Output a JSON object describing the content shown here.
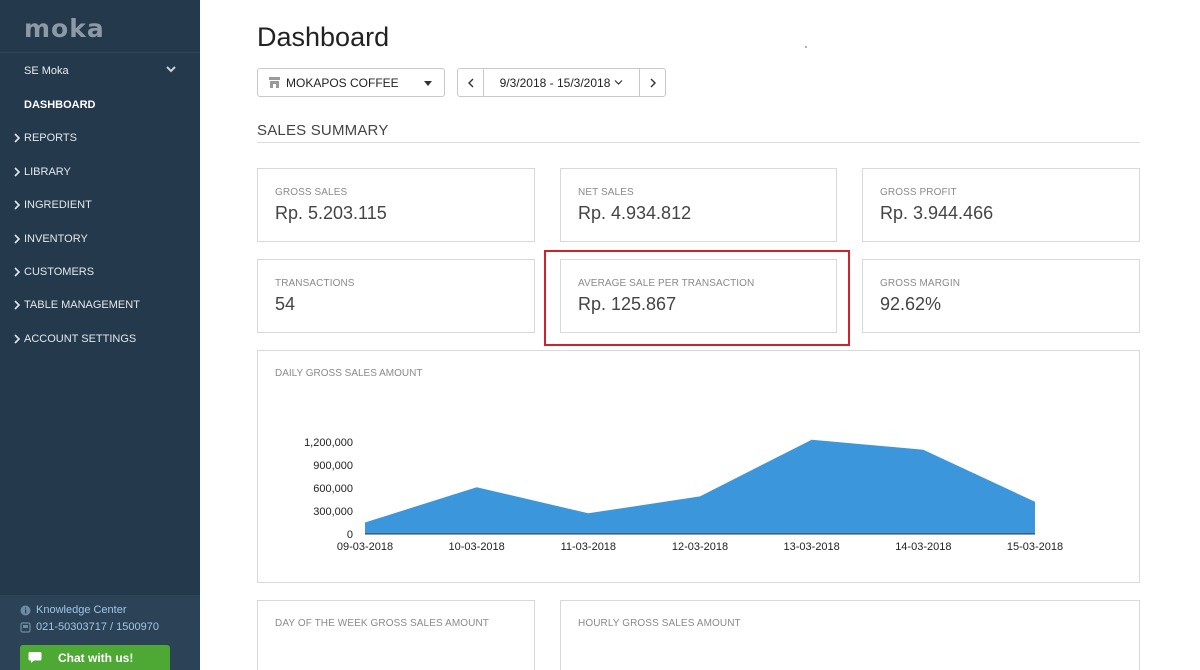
{
  "app": {
    "brand": "moka",
    "account_name": "SE Moka"
  },
  "sidebar": {
    "active_item": "DASHBOARD",
    "items": [
      {
        "label": "REPORTS"
      },
      {
        "label": "LIBRARY"
      },
      {
        "label": "INGREDIENT"
      },
      {
        "label": "INVENTORY"
      },
      {
        "label": "CUSTOMERS"
      },
      {
        "label": "TABLE MANAGEMENT"
      },
      {
        "label": "ACCOUNT SETTINGS"
      }
    ],
    "footer": {
      "knowledge_center": "Knowledge Center",
      "phone": "021-50303717 / 1500970",
      "chat_label": "Chat with us!"
    }
  },
  "page": {
    "title": "Dashboard"
  },
  "filters": {
    "store": "MOKAPOS COFFEE",
    "date_range": "9/3/2018 - 15/3/2018"
  },
  "summary": {
    "title": "SALES SUMMARY",
    "gross_sales": {
      "label": "GROSS SALES",
      "value": "Rp. 5.203.115"
    },
    "net_sales": {
      "label": "NET SALES",
      "value": "Rp. 4.934.812"
    },
    "gross_profit": {
      "label": "GROSS PROFIT",
      "value": "Rp. 3.944.466"
    },
    "transactions": {
      "label": "TRANSACTIONS",
      "value": "54"
    },
    "avg_sale": {
      "label": "AVERAGE SALE PER TRANSACTION",
      "value": "Rp. 125.867"
    },
    "gross_margin": {
      "label": "GROSS MARGIN",
      "value": "92.62%"
    }
  },
  "bottom_cards": {
    "day_of_week": "DAY OF THE WEEK GROSS SALES AMOUNT",
    "hourly": "HOURLY GROSS SALES AMOUNT"
  },
  "colors": {
    "sidebar_bg": "#24394b",
    "area_fill": "#3b96dc",
    "highlight": "#d0222c",
    "chat_green": "#4ea834"
  },
  "chart_data": {
    "type": "area",
    "title": "DAILY GROSS SALES AMOUNT",
    "categories": [
      "09-03-2018",
      "10-03-2018",
      "11-03-2018",
      "12-03-2018",
      "13-03-2018",
      "14-03-2018",
      "15-03-2018"
    ],
    "values": [
      150000,
      610000,
      270000,
      490000,
      1230000,
      1100000,
      420000
    ],
    "yticks": [
      0,
      300000,
      600000,
      900000,
      1200000
    ],
    "ytick_labels": [
      "0",
      "300,000",
      "600,000",
      "900,000",
      "1,200,000"
    ],
    "ylim": [
      0,
      1200000
    ],
    "grid": false,
    "legend": "none"
  }
}
